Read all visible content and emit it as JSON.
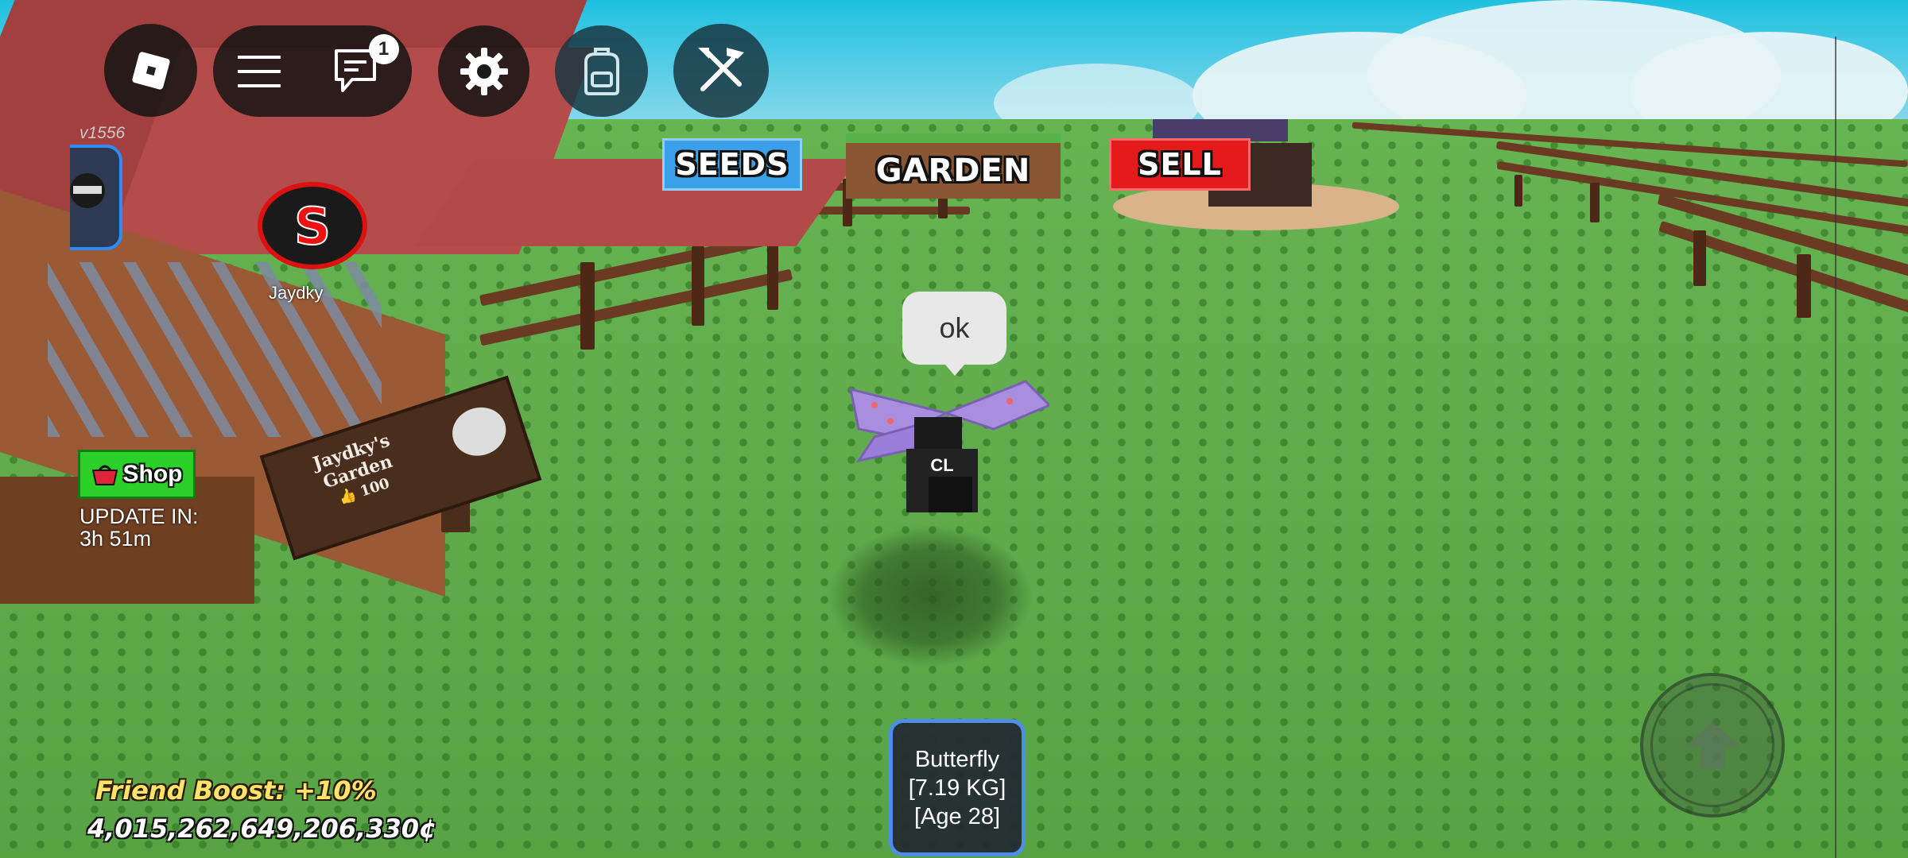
{
  "topbar": {
    "chat_badge": "1",
    "icons": [
      "roblox-logo-icon",
      "menu-icon",
      "chat-icon",
      "settings-gear-icon",
      "backpack-icon",
      "build-tools-icon"
    ]
  },
  "world_buttons": {
    "seeds": "SEEDS",
    "garden": "GARDEN",
    "sell": "SELL",
    "seeds_color": "#3aa0ea",
    "garden_color": "#8a5532",
    "sell_color": "#e51a1a"
  },
  "version": "v1556",
  "player": {
    "name": "Jaydky"
  },
  "garden_sign": {
    "line1": "Jaydky's",
    "line2": "Garden",
    "likes": "100"
  },
  "shop": {
    "label": "Shop",
    "update_label": "UPDATE IN:",
    "update_time": "3h 51m"
  },
  "chat_bubble": {
    "text": "ok"
  },
  "equipped_pet": {
    "name": "Butterfly",
    "weight": "[7.19 KG]",
    "age": "[Age 28]"
  },
  "stats": {
    "friend_boost": "Friend Boost: +10%",
    "money": "4,015,262,649,206,330¢"
  },
  "controls": {
    "jump_icon": "up-arrow-icon"
  }
}
